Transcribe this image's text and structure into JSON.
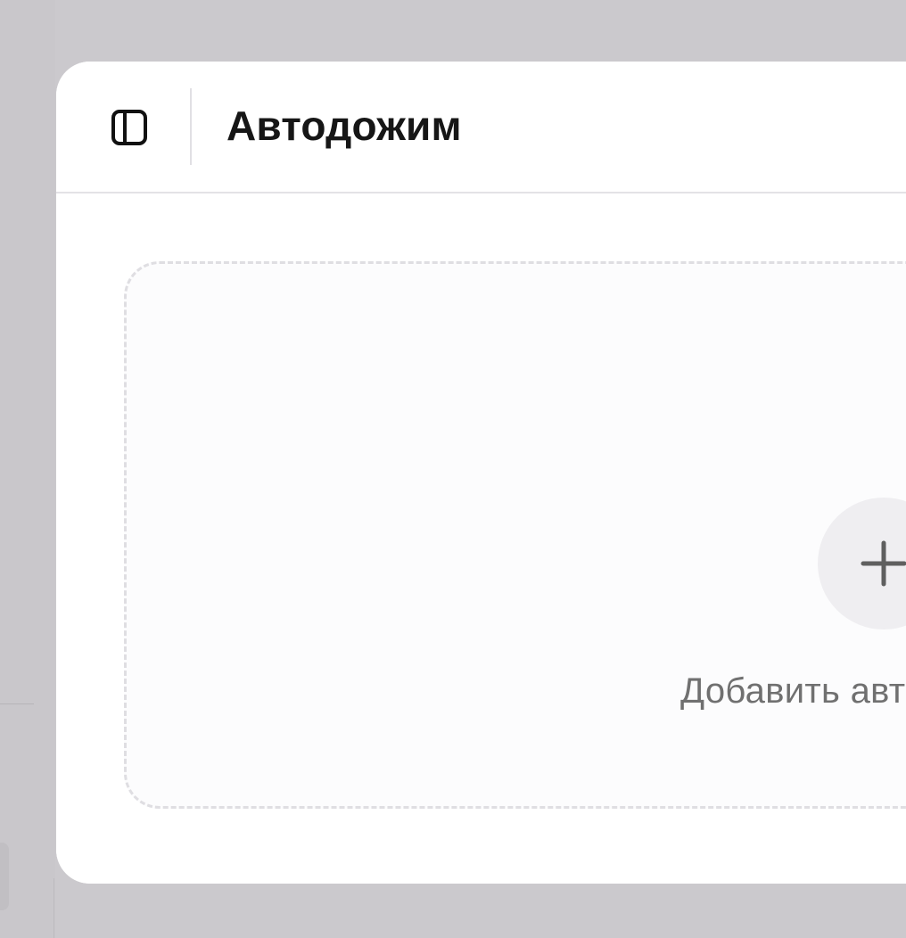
{
  "header": {
    "title": "Автодожим",
    "toggle_icon": "sidebar-toggle-icon"
  },
  "main": {
    "add_label": "Добавить автод",
    "add_icon": "plus-icon"
  },
  "colors": {
    "background": "#cbc9cd",
    "window": "#ffffff",
    "title": "#161616",
    "muted_text": "#707070",
    "circle": "#efeef1",
    "dashed_border": "#dfdee2"
  }
}
